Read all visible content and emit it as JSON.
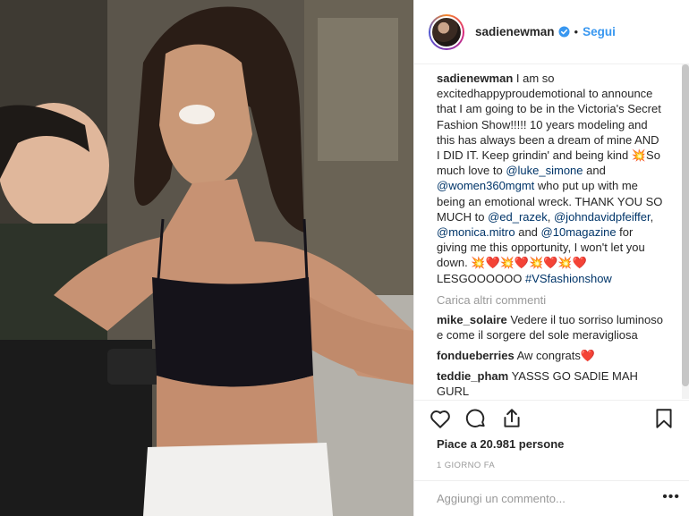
{
  "header": {
    "username": "sadienewman",
    "separator": "•",
    "follow_label": "Segui"
  },
  "caption": {
    "username": "sadienewman",
    "part1": "I am so excitedhappyproudemotional to announce that I am going to be in the Victoria's Secret Fashion Show!!!!! 10 years modeling and this has always been a dream of mine AND I DID IT. Keep grindin' and being kind ",
    "emoji_boom": "💥",
    "part2": "So much love to ",
    "mention1": "@luke_simone",
    "part3": " and ",
    "mention2": "@women360mgmt",
    "part4": " who put up with me being an emotional wreck. THANK YOU SO MUCH to ",
    "mention3": "@ed_razek",
    "part5": ", ",
    "mention4": "@johndavidpfeiffer",
    "part6": ", ",
    "mention5": "@monica.mitro",
    "part7": " and ",
    "mention6": "@10magazine",
    "part8": " for giving me this opportunity, I won't let you down. ",
    "emoji_row": "💥❤️💥❤️💥❤️💥❤️",
    "part9": "LESGOOOOOO ",
    "hashtag": "#VSfashionshow"
  },
  "load_more_label": "Carica altri commenti",
  "comments": [
    {
      "user": "mike_solaire",
      "text": "Vedere il tuo sorriso luminoso e come il sorgere del sole meravigliosa"
    },
    {
      "user": "fondueberries",
      "text": "Aw congrats",
      "emoji": "❤️"
    },
    {
      "user": "teddie_pham",
      "text": "YASSS GO SADIE MAH GURL"
    }
  ],
  "likes_text": "Piace a 20.981 persone",
  "time_ago": "1 GIORNO FA",
  "add_comment_placeholder": "Aggiungi un commento...",
  "more_options": "•••",
  "colors": {
    "link": "#3897f0",
    "mention": "#003569",
    "muted": "#999999",
    "text": "#262626"
  },
  "icons": [
    "heart-icon",
    "comment-icon",
    "share-icon",
    "bookmark-icon",
    "verified-icon"
  ]
}
